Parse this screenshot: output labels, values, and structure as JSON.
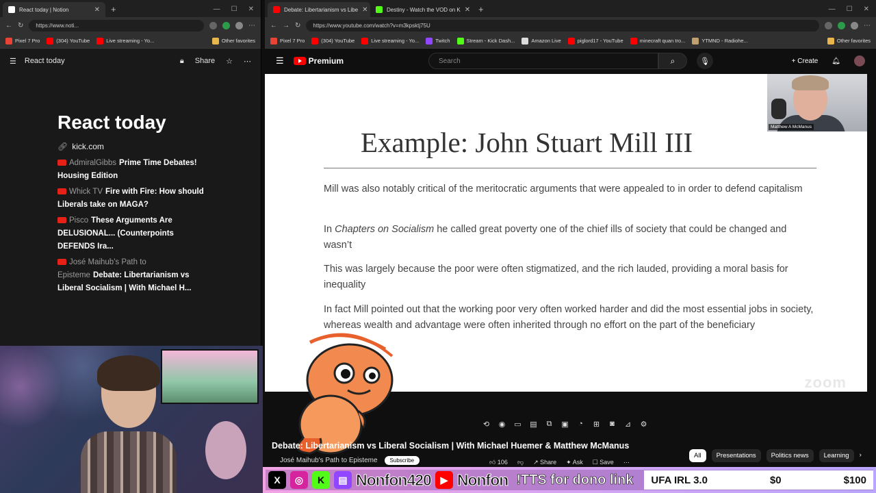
{
  "left_browser": {
    "tab_title": "React today | Notion",
    "url": "https://www.noti...",
    "bookmarks": [
      "Pixel 7 Pro",
      "(304) YouTube",
      "Live streaming - Yo..."
    ],
    "other_favorites": "Other favorites"
  },
  "notion": {
    "breadcrumb": "React today",
    "share_label": "Share",
    "page_title": "React today",
    "link": "kick.com",
    "items": [
      {
        "channel": "AdmiralGibbs",
        "title": "Prime Time Debates! Housing Edition"
      },
      {
        "channel": "Whick TV",
        "title": "Fire with Fire: How should Liberals take on MAGA?"
      },
      {
        "channel": "Pisco",
        "title": "These Arguments Are DELUSIONAL... (Counterpoints DEFENDS Ira..."
      },
      {
        "channel": "José Maihub's Path to Episteme",
        "title": "Debate: Libertarianism vs Liberal Socialism | With Michael H..."
      }
    ]
  },
  "right_browser": {
    "tabs": [
      "Debate: Libertarianism vs Libe",
      "Destiny - Watch the VOD on K"
    ],
    "url": "https://www.youtube.com/watch?v=m3kpsktj75U",
    "bookmarks": [
      "Pixel 7 Pro",
      "(304) YouTube",
      "Live streaming - Yo...",
      "Twitch",
      "Stream - Kick Dash...",
      "Amazon Live",
      "piglord17 - YouTube",
      "minecraft quan tro...",
      "YTMND - Radiohe..."
    ],
    "other_favorites": "Other favorites"
  },
  "youtube": {
    "logo_text": "Premium",
    "search_placeholder": "Search",
    "create_label": "Create",
    "slide": {
      "title": "Example: John Stuart Mill III",
      "p1": "Mill was also notably critical of the meritocratic arguments that were appealed to in order to defend capitalism",
      "p2_pre": "In ",
      "p2_em": "Chapters on Socialism",
      "p2_post": " he called great poverty one of the chief ills of society that could be changed and wasn’t",
      "p3": "This was largely because the poor were often stigmatized, and the rich lauded, providing a moral basis for inequality",
      "p4": "In fact Mill pointed out that the working poor very often worked harder and did the most essential jobs in society, whereas wealth and advantage were often inherited through no effort on the part of the beneficiary"
    },
    "zoom_name": "Matthew A McManus",
    "zoom_watermark": "zoom",
    "video_title": "Debate: Libertarianism vs Liberal Socialism | With Michael Huemer & Matthew McManus",
    "channel": "José Maihub's Path to Episteme",
    "subscribe_label": "Subscribe",
    "likes": "106",
    "share_label": "Share",
    "ask_label": "Ask",
    "save_label": "Save",
    "chips": [
      "All",
      "Presentations",
      "Politics news",
      "Learning"
    ]
  },
  "overlay": {
    "name1": "Nonfon420",
    "name2": "Nonfon",
    "tts": "!TTS for dono link",
    "goal_name": "UFA IRL 3.0",
    "goal_current": "$0",
    "goal_target": "$100"
  }
}
